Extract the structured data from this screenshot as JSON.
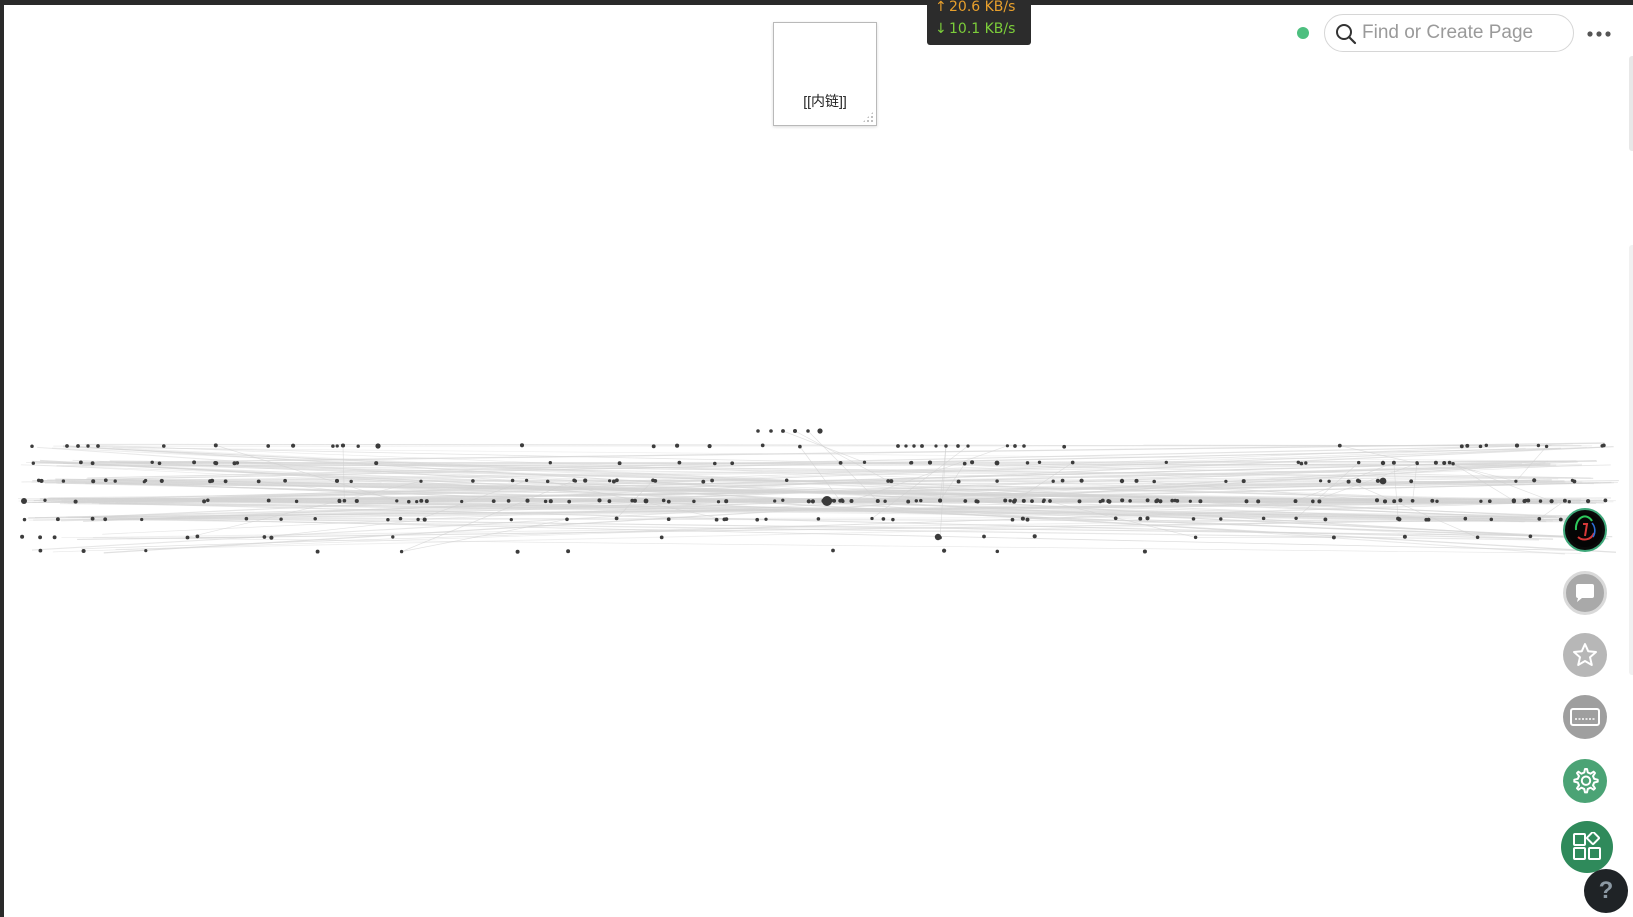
{
  "network_badge": {
    "upload": "20.6 KB/s",
    "download": "10.1 KB/s",
    "up_color": "#e8a02c",
    "down_color": "#7ccd3a"
  },
  "popup_card": {
    "label": "[[内链]]"
  },
  "header": {
    "status": "connected",
    "status_color": "#4dbf7f",
    "search_placeholder": "Find or Create Page",
    "more_icon": "ellipsis-icon"
  },
  "dock": {
    "items": [
      {
        "name": "avatar",
        "icon": "user-avatar-icon"
      },
      {
        "name": "chat",
        "icon": "chat-bubble-icon"
      },
      {
        "name": "favorites",
        "icon": "star-icon"
      },
      {
        "name": "keyboard",
        "icon": "keyboard-icon"
      },
      {
        "name": "settings",
        "icon": "gear-icon"
      },
      {
        "name": "apps",
        "icon": "apps-grid-icon"
      }
    ],
    "accent": "#2f8a5b"
  },
  "help": {
    "label": "?"
  }
}
